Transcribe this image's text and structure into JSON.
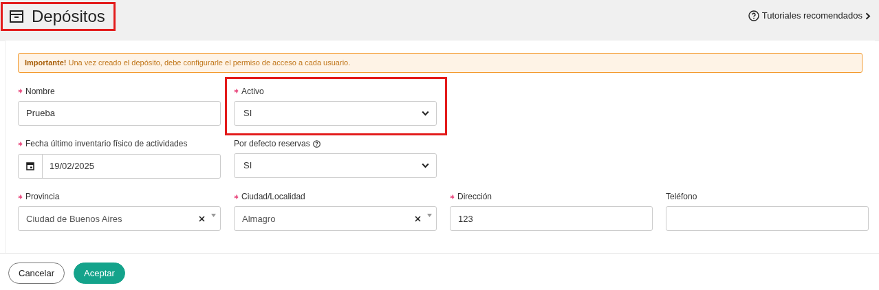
{
  "header": {
    "title": "Depósitos",
    "highlighted": true,
    "tutorials_link": "Tutoriales recomendados"
  },
  "alert": {
    "strong": "Importante!",
    "text": "Una vez creado el depósito, debe configurarle el permiso de acceso a cada usuario."
  },
  "form_rows": [
    [
      {
        "kind": "text",
        "label": "Nombre",
        "required": true,
        "help": false,
        "value": "Prueba"
      },
      {
        "kind": "select",
        "label": "Activo",
        "required": true,
        "help": false,
        "highlighted": true,
        "value": "SI"
      }
    ],
    [
      {
        "kind": "date",
        "label": "Fecha último inventario físico de actividades",
        "required": true,
        "help": false,
        "value": "19/02/2025"
      },
      {
        "kind": "select",
        "label": "Por defecto reservas",
        "required": false,
        "help": true,
        "value": "SI"
      }
    ],
    [
      {
        "kind": "combo",
        "label": "Provincia",
        "required": true,
        "help": false,
        "value": "Ciudad de Buenos Aires"
      },
      {
        "kind": "combo",
        "label": "Ciudad/Localidad",
        "required": true,
        "help": false,
        "value": "Almagro"
      },
      {
        "kind": "text",
        "label": "Dirección",
        "required": true,
        "help": false,
        "value": "123"
      },
      {
        "kind": "text",
        "label": "Teléfono",
        "required": false,
        "help": false
      }
    ]
  ],
  "buttons": [
    {
      "label": "Cancelar",
      "kind": "secondary"
    },
    {
      "label": "Aceptar",
      "kind": "primary"
    }
  ]
}
